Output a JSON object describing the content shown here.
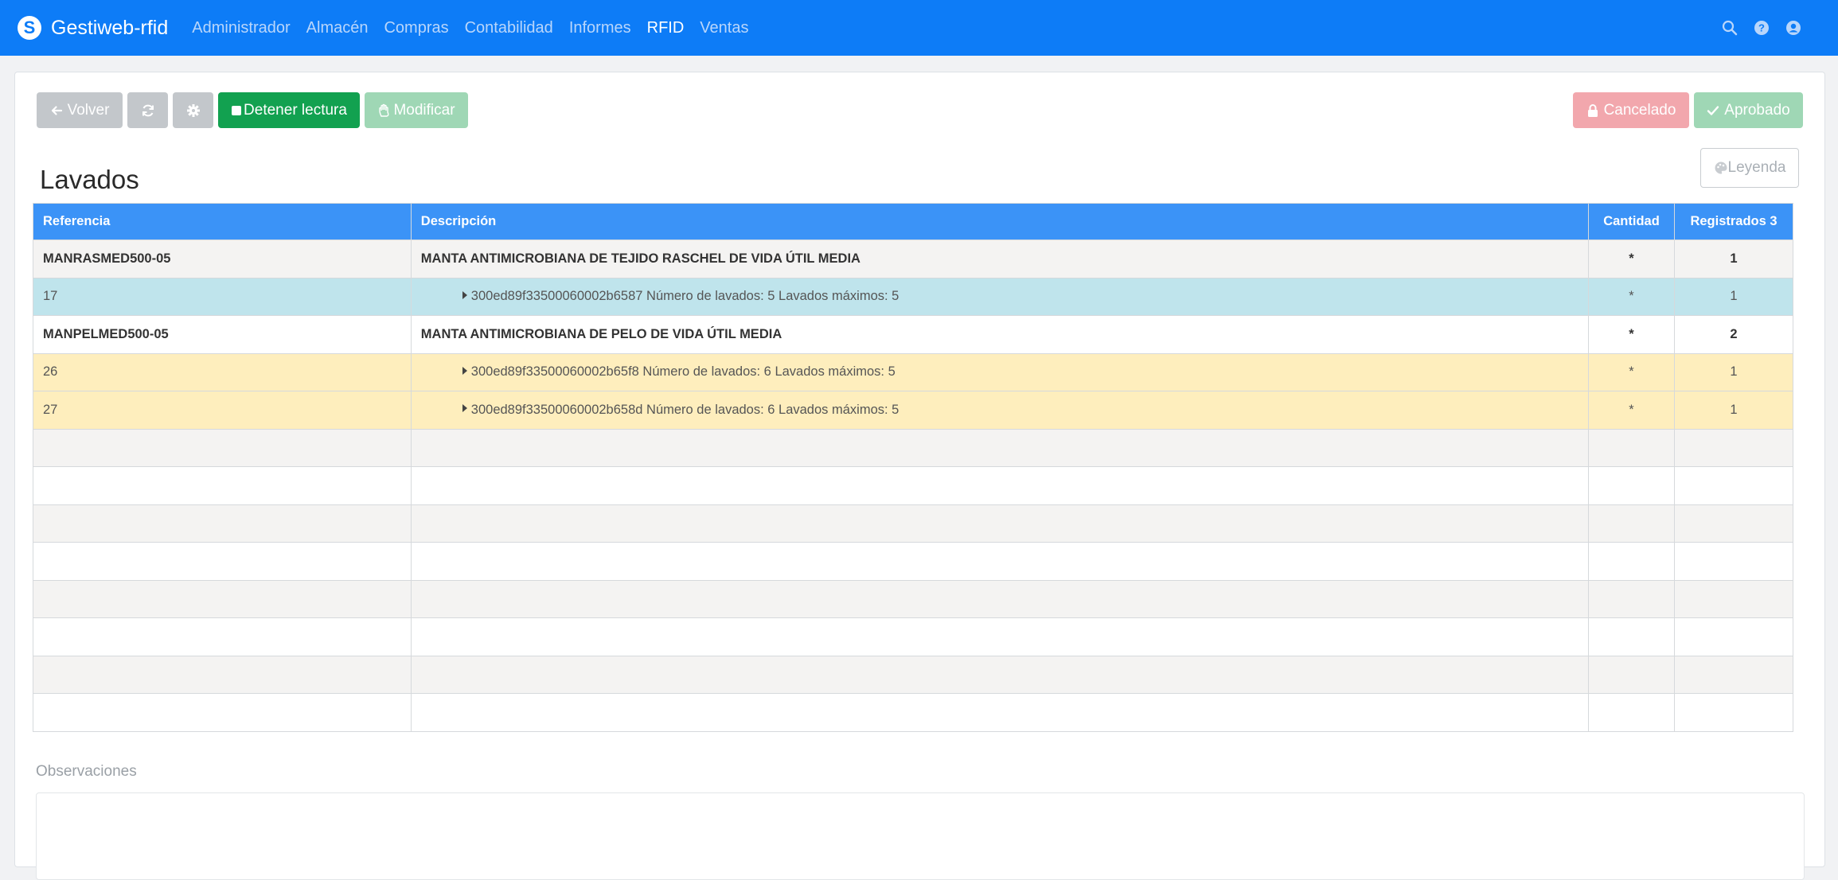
{
  "navbar": {
    "brand": "Gestiweb-rfid",
    "menu": [
      {
        "label": "Administrador",
        "active": false
      },
      {
        "label": "Almacén",
        "active": false
      },
      {
        "label": "Compras",
        "active": false
      },
      {
        "label": "Contabilidad",
        "active": false
      },
      {
        "label": "Informes",
        "active": false
      },
      {
        "label": "RFID",
        "active": true
      },
      {
        "label": "Ventas",
        "active": false
      }
    ],
    "icons": [
      "search-icon",
      "help-icon",
      "user-icon"
    ]
  },
  "toolbar": {
    "back_label": "Volver",
    "stop_label": "Detener lectura",
    "modify_label": "Modificar",
    "cancel_label": "Cancelado",
    "approve_label": "Aprobado",
    "legend_label": "Leyenda"
  },
  "page": {
    "title": "Lavados"
  },
  "table": {
    "headers": {
      "reference": "Referencia",
      "description": "Descripción",
      "quantity": "Cantidad",
      "registered": "Registrados 3"
    },
    "rows": [
      {
        "reference": "MANRASMED500-05",
        "description": "MANTA ANTIMICROBIANA DE TEJIDO RASCHEL DE VIDA ÚTIL MEDIA",
        "quantity": "*",
        "registered": "1"
      },
      {
        "reference": "17",
        "description": "300ed89f33500060002b6587 Número de lavados: 5 Lavados máximos: 5",
        "quantity": "*",
        "registered": "1"
      },
      {
        "reference": "MANPELMED500-05",
        "description": "MANTA ANTIMICROBIANA DE PELO DE VIDA ÚTIL MEDIA",
        "quantity": "*",
        "registered": "2"
      },
      {
        "reference": "26",
        "description": "300ed89f33500060002b65f8 Número de lavados: 6 Lavados máximos: 5",
        "quantity": "*",
        "registered": "1"
      },
      {
        "reference": "27",
        "description": "300ed89f33500060002b658d Número de lavados: 6 Lavados máximos: 5",
        "quantity": "*",
        "registered": "1"
      }
    ]
  },
  "observations": {
    "label": "Observaciones"
  },
  "colors": {
    "navbar": "#0d7cf7",
    "table_header": "#3b93f7",
    "row_blue": "#bfe4ec",
    "row_yellow": "#feeebd",
    "green": "#12a150"
  }
}
